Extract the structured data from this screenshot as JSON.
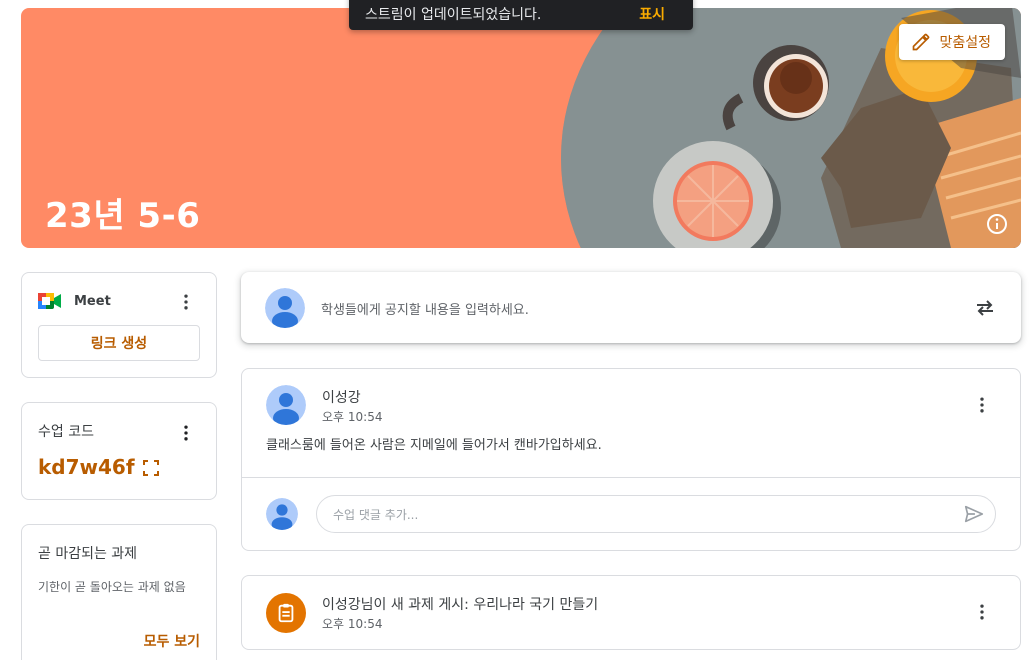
{
  "snackbar": {
    "message": "스트림이 업데이트되었습니다.",
    "action": "표시"
  },
  "banner": {
    "class_title": "23년 5-6",
    "customize_label": "맞춤설정"
  },
  "meet": {
    "label": "Meet",
    "link_button": "링크 생성"
  },
  "class_code": {
    "title": "수업 코드",
    "value": "kd7w46f"
  },
  "upcoming": {
    "title": "곧 마감되는 과제",
    "description": "기한이 곧 돌아오는 과제 없음",
    "view_all": "모두 보기"
  },
  "announce": {
    "placeholder": "학생들에게 공지할 내용을 입력하세요."
  },
  "post": {
    "author": "이성강",
    "time": "오후 10:54",
    "body": "클래스룸에 들어온 사람은 지메일에 들어가서 캔바가입하세요.",
    "comment_placeholder": "수업 댓글 추가..."
  },
  "assignment": {
    "heading": "이성강님이 새 과제 게시: 우리나라 국기 만들기",
    "time": "오후 10:54"
  },
  "colors": {
    "accent": "#b85c00",
    "banner": "#ff8a65",
    "assignment_icon": "#e37400"
  }
}
